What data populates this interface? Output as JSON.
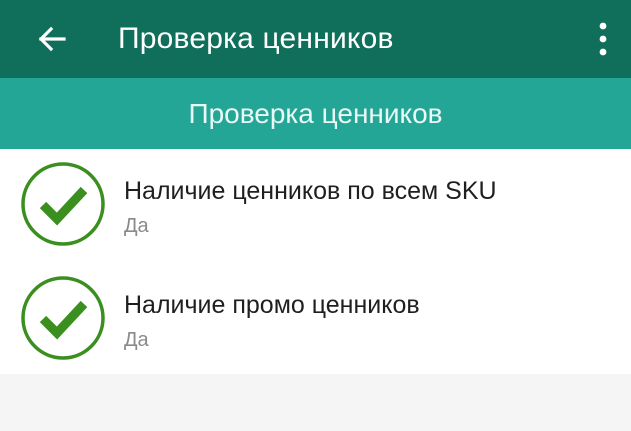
{
  "app_bar": {
    "title": "Проверка ценников",
    "back_icon": "arrow-left-icon",
    "menu_icon": "more-vertical-icon",
    "color": "#0f6f5b"
  },
  "section": {
    "title": "Проверка ценников",
    "color": "#24a697"
  },
  "items": [
    {
      "title": "Наличие ценников по всем SKU",
      "value": "Да",
      "icon": "check-circle-icon"
    },
    {
      "title": "Наличие промо ценников",
      "value": "Да",
      "icon": "check-circle-icon"
    }
  ],
  "colors": {
    "check": "#3a8f1f"
  }
}
